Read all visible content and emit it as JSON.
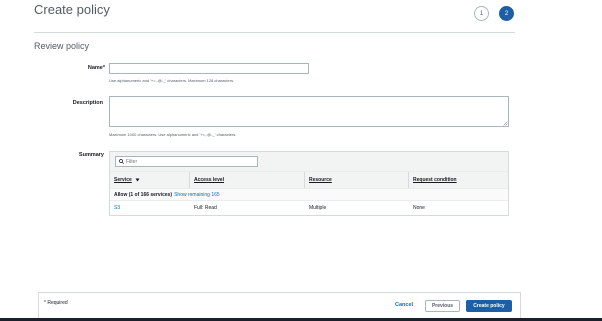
{
  "page": {
    "title": "Create policy",
    "steps": [
      "1",
      "2"
    ],
    "active_step": "2"
  },
  "review": {
    "section_title": "Review policy",
    "name_label": "Name*",
    "name_value": "",
    "name_hint": "Use alphanumeric and '+=,.@-_' characters. Maximum 128 characters.",
    "description_label": "Description",
    "description_value": "",
    "description_hint": "Maximum 1000 characters. Use alphanumeric and '+=,.@-_' characters.",
    "summary_label": "Summary"
  },
  "summary": {
    "filter_placeholder": "Filter",
    "columns": [
      "Service",
      "Access level",
      "Resource",
      "Request condition"
    ],
    "group_label": "Allow (1 of 166 services)",
    "group_link": "Show remaining 165",
    "rows": [
      {
        "service": "S3",
        "access_level": "Full: Read",
        "resource": "Multiple",
        "request_condition": "None"
      }
    ]
  },
  "footer": {
    "required_note": "* Required",
    "cancel_label": "Cancel",
    "previous_label": "Previous",
    "create_label": "Create policy"
  },
  "colors": {
    "primary": "#1d5fa6",
    "link": "#0073bb"
  }
}
